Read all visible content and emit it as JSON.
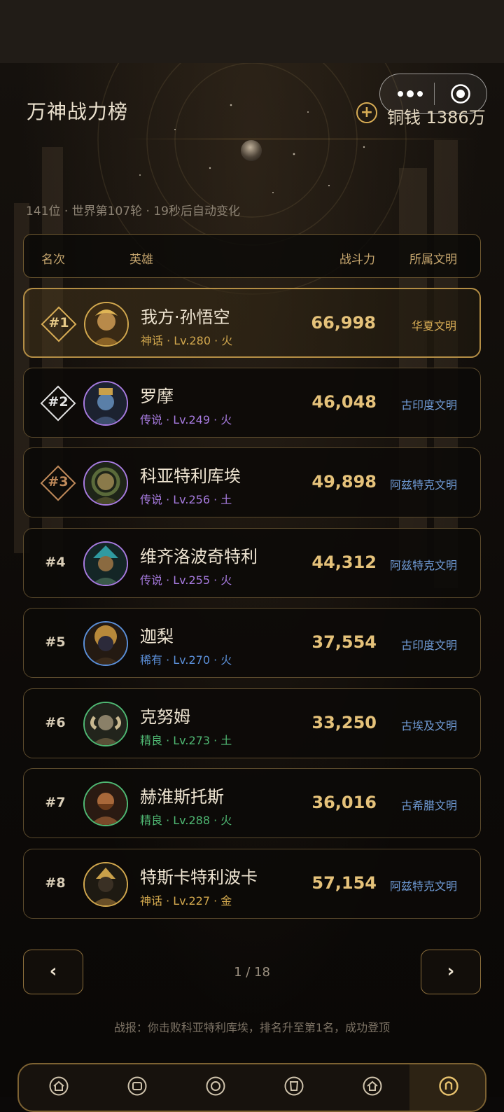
{
  "app": {
    "title": "万神战力榜",
    "coins_label": "铜钱 1386万"
  },
  "status": "141位 · 世界第107轮 · 19秒后自动变化",
  "table": {
    "headers": {
      "rank": "名次",
      "hero": "英雄",
      "power": "战斗力",
      "civ": "所属文明"
    },
    "rows": [
      {
        "rank": "#1",
        "name": "我方·孙悟空",
        "meta": "神话 · Lv.280 · 火",
        "power": "66,998",
        "civ": "华夏文明"
      },
      {
        "rank": "#2",
        "name": "罗摩",
        "meta": "传说 · Lv.249 · 火",
        "power": "46,048",
        "civ": "古印度文明"
      },
      {
        "rank": "#3",
        "name": "科亚特利库埃",
        "meta": "传说 · Lv.256 · 土",
        "power": "49,898",
        "civ": "阿兹特克文明"
      },
      {
        "rank": "#4",
        "name": "维齐洛波奇特利",
        "meta": "传说 · Lv.255 · 火",
        "power": "44,312",
        "civ": "阿兹特克文明"
      },
      {
        "rank": "#5",
        "name": "迦梨",
        "meta": "稀有 · Lv.270 · 火",
        "power": "37,554",
        "civ": "古印度文明"
      },
      {
        "rank": "#6",
        "name": "克努姆",
        "meta": "精良 · Lv.273 · 土",
        "power": "33,250",
        "civ": "古埃及文明"
      },
      {
        "rank": "#7",
        "name": "赫淮斯托斯",
        "meta": "精良 · Lv.288 · 火",
        "power": "36,016",
        "civ": "古希腊文明"
      },
      {
        "rank": "#8",
        "name": "特斯卡特利波卡",
        "meta": "神话 · Lv.227 · 金",
        "power": "57,154",
        "civ": "阿兹特克文明"
      }
    ]
  },
  "pager": {
    "prev": "‹",
    "next": "›",
    "text": "1 / 18"
  },
  "report": "战报：你击败科亚特利库埃，排名升至第1名，成功登顶",
  "colors": {
    "gold": "#d8ad55",
    "mythic": "#d2a84e",
    "legendary": "#a77be0",
    "rare": "#5b8fd8",
    "fine": "#4fb873",
    "civ_blue": "#6f9bd6",
    "civ_gold": "#d8ad55"
  },
  "icons": {
    "capsule": [
      "more-icon",
      "target-icon"
    ],
    "nav": [
      "tab-1-icon",
      "tab-2-icon",
      "tab-3-icon",
      "tab-4-icon",
      "home-icon",
      "rank-icon"
    ]
  }
}
